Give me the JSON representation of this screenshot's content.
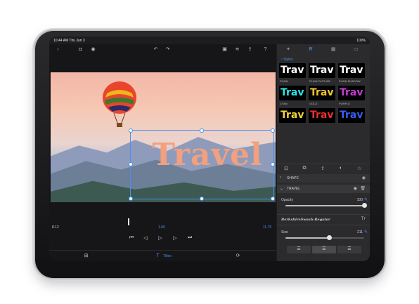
{
  "status": {
    "time_date": "10:44 AM   Thu Jun 3",
    "battery": "100%"
  },
  "editor": {
    "preview_text": "Travel",
    "timeline": {
      "time_left": "8.12",
      "time_center": "1.00",
      "time_right": "11.75"
    },
    "bottom_tab": "Titles"
  },
  "inspector": {
    "back_label": "Styles",
    "styles": [
      {
        "text": "Trav",
        "label": "PLAIN",
        "color": "#ffffff"
      },
      {
        "text": "Trav",
        "label": "PLAIN OUTLINE",
        "color": "#ffffff"
      },
      {
        "text": "Trav",
        "label": "PLAIN SHADOW",
        "color": "#ffffff"
      },
      {
        "text": "Trav",
        "label": "CYAN",
        "color": "#2ee6e6"
      },
      {
        "text": "Trav",
        "label": "GOLD",
        "color": "#f2c230"
      },
      {
        "text": "Trav",
        "label": "PURPLE",
        "color": "#c43bd6"
      },
      {
        "text": "Trav",
        "label": "",
        "color": "#f2d23a"
      },
      {
        "text": "Trav",
        "label": "",
        "color": "#e8302e"
      },
      {
        "text": "Trav",
        "label": "",
        "color": "#3a5ef2"
      }
    ],
    "shape_label": "SHAPE",
    "layer_label": "TRAVEL",
    "opacity": {
      "label": "Opacity",
      "value": "100",
      "fraction": 1.0
    },
    "font_name": "BerkshireSwash-Regular",
    "size": {
      "label": "Size",
      "value": "211",
      "fraction": 0.55
    },
    "auto_size_label": "Auto Size for Text",
    "line_spacing": {
      "label": "Line Spacing",
      "value": "100%",
      "fraction": 0.3
    }
  },
  "colors": {
    "accent": "#4a8ff0",
    "preview_text": "#f2a07e"
  }
}
